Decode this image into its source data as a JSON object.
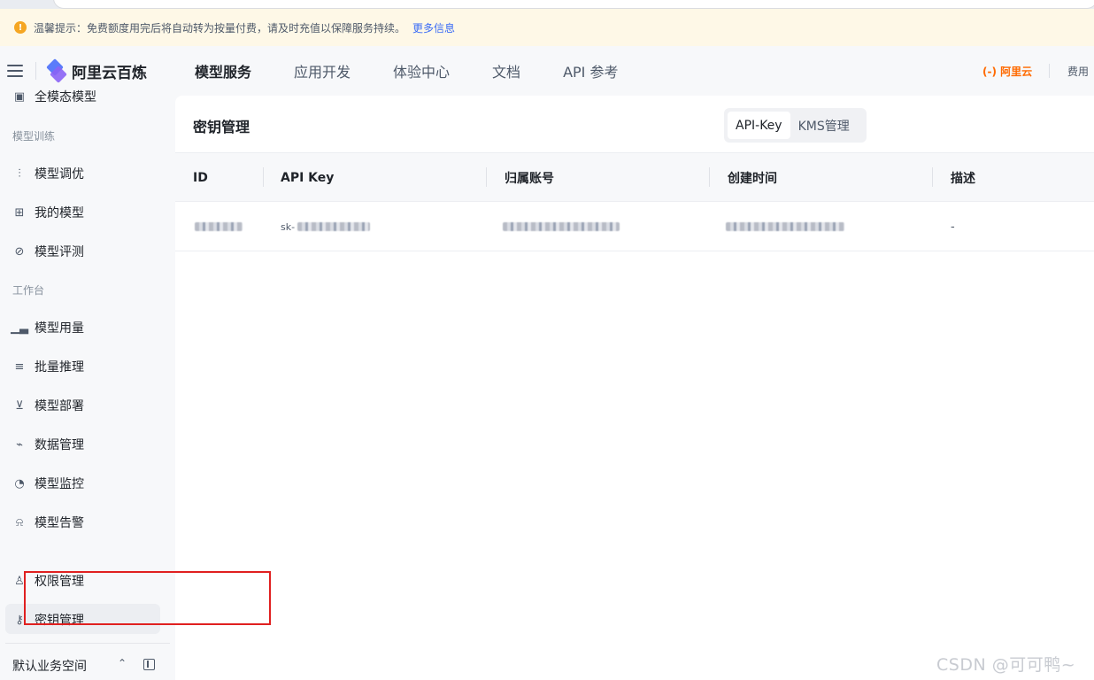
{
  "notice": {
    "text": "温馨提示：免费额度用完后将自动转为按量付费，请及时充值以保障服务持续。",
    "link": "更多信息",
    "icon": "warning-icon"
  },
  "header": {
    "logo_text": "阿里云百炼",
    "nav": [
      "模型服务",
      "应用开发",
      "体验中心",
      "文档",
      "API 参考"
    ],
    "active_nav": "模型服务",
    "brand": "(-) 阿里云",
    "fee": "费用"
  },
  "sidebar": {
    "partial_top_item": "全模态模型",
    "group_training": "模型训练",
    "training_items": [
      {
        "label": "模型调优",
        "icon": "sliders-icon"
      },
      {
        "label": "我的模型",
        "icon": "grid-icon"
      },
      {
        "label": "模型评测",
        "icon": "compass-icon"
      }
    ],
    "group_workbench": "工作台",
    "workbench_items": [
      {
        "label": "模型用量",
        "icon": "bar-chart-icon"
      },
      {
        "label": "批量推理",
        "icon": "list-icon"
      },
      {
        "label": "模型部署",
        "icon": "deploy-icon"
      },
      {
        "label": "数据管理",
        "icon": "trend-icon"
      },
      {
        "label": "模型监控",
        "icon": "pie-icon"
      },
      {
        "label": "模型告警",
        "icon": "bell-icon"
      }
    ],
    "permission": {
      "label": "权限管理",
      "icon": "user-icon"
    },
    "keys": {
      "label": "密钥管理",
      "icon": "key-icon"
    },
    "workspace": "默认业务空间"
  },
  "main": {
    "title": "密钥管理",
    "tabs": [
      "API-Key",
      "KMS管理"
    ],
    "active_tab": "API-Key",
    "columns": [
      "ID",
      "API Key",
      "归属账号",
      "创建时间",
      "描述"
    ],
    "rows": [
      {
        "id": "",
        "api_key": "sk-",
        "account": "",
        "created": "",
        "desc": "-"
      }
    ]
  },
  "watermark": "CSDN @可可鸭~",
  "colors": {
    "accent": "#3b6cf6",
    "brand_orange": "#ff6a00",
    "annotation_red": "#e02020"
  }
}
